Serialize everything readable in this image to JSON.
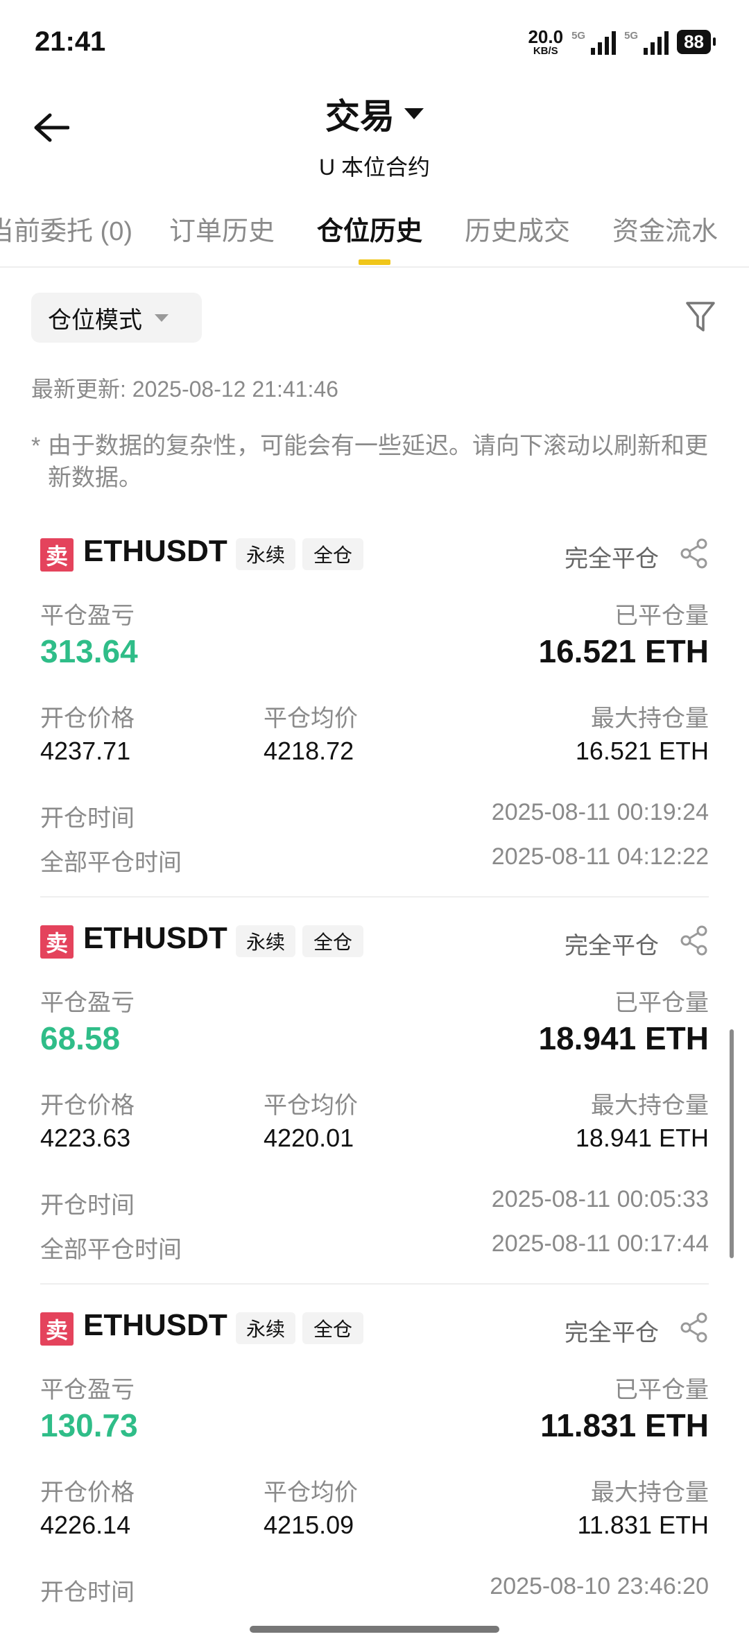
{
  "status_bar": {
    "time": "21:41",
    "net_speed": "20.0",
    "net_unit": "KB/S",
    "signal_1": "5G",
    "signal_2": "5G",
    "battery": "88"
  },
  "header": {
    "title": "交易",
    "subtitle": "U 本位合约"
  },
  "tabs": [
    "当前委托 (0)",
    "订单历史",
    "仓位历史",
    "历史成交",
    "资金流水"
  ],
  "active_tab": "仓位历史",
  "filter": {
    "mode_label": "仓位模式"
  },
  "updated_text": "最新更新: 2025-08-12 21:41:46",
  "notice": {
    "star": "*",
    "text": "由于数据的复杂性，可能会有一些延迟。请向下滚动以刷新和更新数据。"
  },
  "labels": {
    "side": "卖",
    "tag_perpetual": "永续",
    "tag_cross": "全仓",
    "status": "完全平仓",
    "pnl": "平仓盈亏",
    "closed_qty": "已平仓量",
    "open_price": "开仓价格",
    "close_avg": "平仓均价",
    "max_pos": "最大持仓量",
    "open_time": "开仓时间",
    "close_time": "全部平仓时间"
  },
  "records": [
    {
      "symbol": "ETHUSDT",
      "pnl": "313.64",
      "closed_qty": "16.521 ETH",
      "open_price": "4237.71",
      "close_avg": "4218.72",
      "max_pos": "16.521 ETH",
      "open_time": "2025-08-11 00:19:24",
      "close_time": "2025-08-11 04:12:22"
    },
    {
      "symbol": "ETHUSDT",
      "pnl": "68.58",
      "closed_qty": "18.941 ETH",
      "open_price": "4223.63",
      "close_avg": "4220.01",
      "max_pos": "18.941 ETH",
      "open_time": "2025-08-11 00:05:33",
      "close_time": "2025-08-11 00:17:44"
    },
    {
      "symbol": "ETHUSDT",
      "pnl": "130.73",
      "closed_qty": "11.831 ETH",
      "open_price": "4226.14",
      "close_avg": "4215.09",
      "max_pos": "11.831 ETH",
      "open_time": "2025-08-10 23:46:20"
    }
  ],
  "colors": {
    "profit": "#2fbd88",
    "sell": "#e4435c",
    "accent": "#f0c61a"
  }
}
